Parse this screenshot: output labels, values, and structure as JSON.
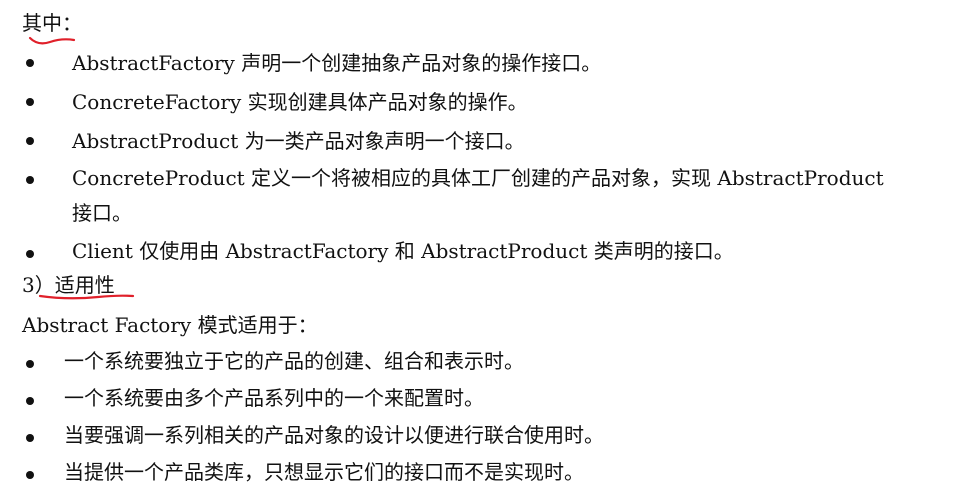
{
  "section_intro": "其中：",
  "participants": [
    {
      "text": "AbstractFactory 声明一个创建抽象产品对象的操作接口。"
    },
    {
      "text": "ConcreteFactory 实现创建具体产品对象的操作。"
    },
    {
      "text": "AbstractProduct 为一类产品对象声明一个接口。"
    },
    {
      "text": "ConcreteProduct 定义一个将被相应的具体工厂创建的产品对象，实现 AbstractProduct",
      "continuation": "接口。"
    },
    {
      "text": "Client 仅使用由 AbstractFactory 和 AbstractProduct 类声明的接口。"
    }
  ],
  "applicability_heading": {
    "number": "3）",
    "title": "适用性"
  },
  "applicability_intro": "Abstract Factory 模式适用于：",
  "applicability_items": [
    {
      "text": "一个系统要独立于它的产品的创建、组合和表示时。"
    },
    {
      "text": "一个系统要由多个产品系列中的一个来配置时。"
    },
    {
      "text": "当要强调一系列相关的产品对象的设计以便进行联合使用时。"
    },
    {
      "text": "当提供一个产品类库，只想显示它们的接口而不是实现时。"
    }
  ],
  "annotation_color": "#e0202a"
}
